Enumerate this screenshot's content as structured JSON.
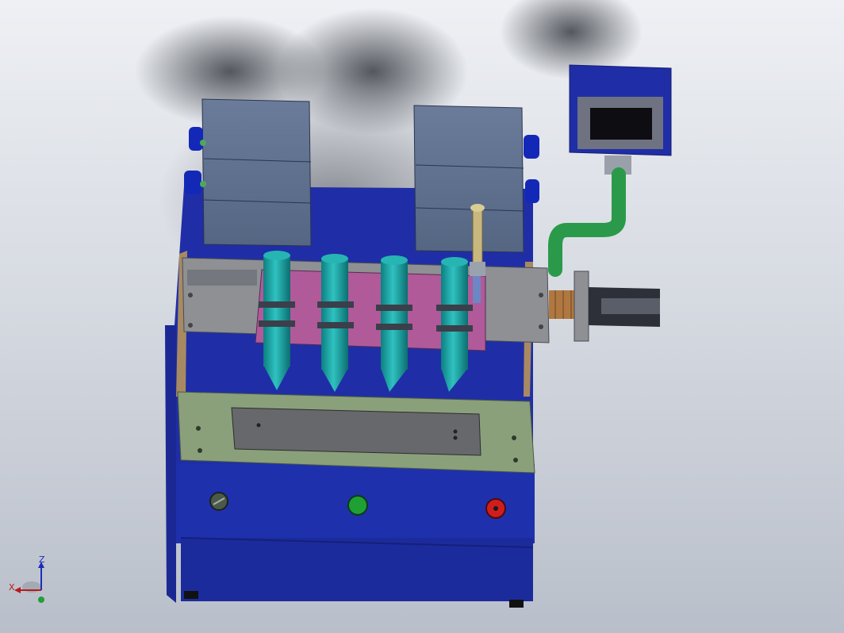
{
  "viewport": {
    "background_top": "#eef0f4",
    "background_bottom": "#b9bfca"
  },
  "colors": {
    "frame_blue": "#1f2fa8",
    "plate_green": "#8aa07a",
    "motor_box": "#5c6f8e",
    "nozzle_teal": "#19a3a3",
    "carriage_pink": "#b05a9a",
    "hose_green": "#2a9a4a",
    "panel_gray": "#8e9094",
    "button_green": "#1fa035",
    "button_red": "#d01e1e"
  },
  "triad": {
    "z_label": "Z",
    "x_label": "X"
  },
  "components": {
    "nozzles": [
      "nozzle-1",
      "nozzle-2",
      "nozzle-3",
      "nozzle-4"
    ],
    "buttons": [
      "knob-button",
      "start-button",
      "stop-button"
    ]
  }
}
